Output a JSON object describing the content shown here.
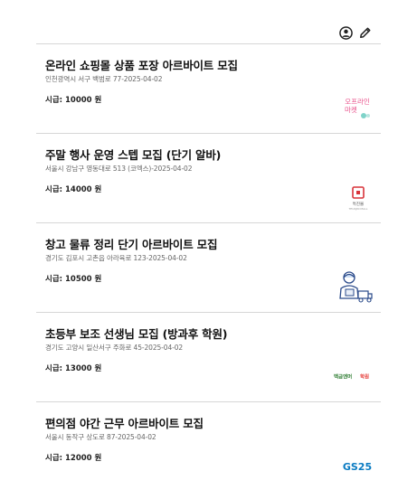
{
  "header": {
    "icons": [
      "user-circle-icon",
      "pencil-icon"
    ]
  },
  "jobs": [
    {
      "title": "온라인 쇼핑몰 상품 포장 아르바이트 모집",
      "subtitle": "인천광역시 서구 백범로 77-2025-04-02",
      "pay": "시급: 10000 원",
      "logo_text": "오프라인\n마켓",
      "accent": "#e8508a"
    },
    {
      "title": "주말 행사 운영 스텝 모집 (단기 알바)",
      "subtitle": "서울시 강남구 영동대로 513 (코엑스)-2025-04-02",
      "pay": "시급: 14000 원",
      "logo_text": "특진몰",
      "accent": "#d8333a"
    },
    {
      "title": "창고 물류 정리 단기 아르바이트 모집",
      "subtitle": "경기도 김포시 고촌읍 아라육로 123-2025-04-02",
      "pay": "시급: 10500 원",
      "logo_text": "",
      "accent": "#2a4a8a"
    },
    {
      "title": "초등부 보조 선생님 모집 (방과후 학원)",
      "subtitle": "경기도 고양시 일산서구 주화로 45-2025-04-02",
      "pay": "시급: 13000 원",
      "logo_text": "백금엔머학원",
      "accent": "#2e7d32"
    },
    {
      "title": "편의점 야간 근무 아르바이트 모집",
      "subtitle": "서울시 동작구 상도로 87-2025-04-02",
      "pay": "시급: 12000 원",
      "logo_text": "GS25",
      "accent": "#0a7bc2"
    }
  ]
}
